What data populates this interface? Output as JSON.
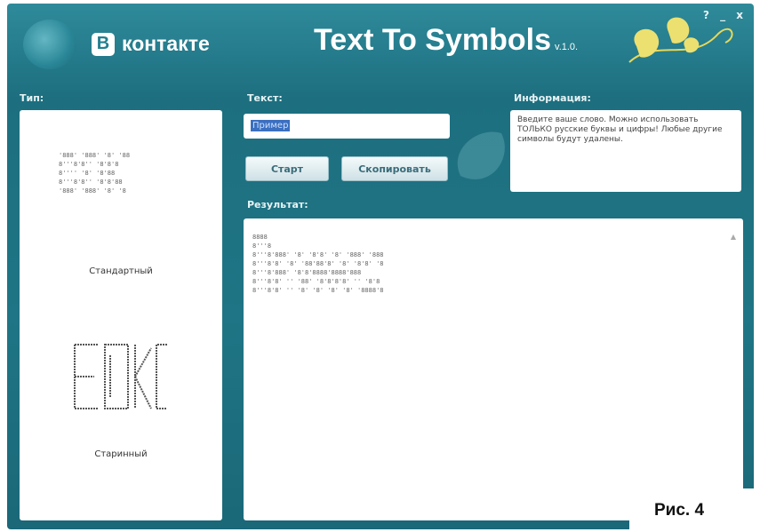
{
  "window": {
    "controls": "? _ x",
    "brand_icon": "B",
    "brand_text": "контакте",
    "app_title": "Text To Symbols",
    "app_version": "v.1.0."
  },
  "type_section": {
    "label": "Тип:",
    "standard_preview": "'888' '888' '8' '88\n8'''8'8'' '8'8'8\n8'''' '8' '8'88\n8'''8'8'' '8'8'88\n'888' '888' '8' '8",
    "standard_label": "Стандартный",
    "old_label": "Старинный"
  },
  "text_section": {
    "label": "Текст:",
    "input_value": "Пример"
  },
  "buttons": {
    "start": "Старт",
    "copy": "Скопировать"
  },
  "info_section": {
    "label": "Информация:",
    "text": "Введите ваше слово. Можно использовать ТОЛЬКО русские буквы и цифры! Любые другие символы будут удалены."
  },
  "result_section": {
    "label": "Результат:",
    "text": "8888\n8'''8\n8'''8'888' '8' '8'8' '8' '888' '888\n8'''8'8' '8' '88'88'8' '8' '8'8' '8\n8'''8'888' '8'8'8888'8888'888\n8'''8'8' '' '88' '8'8'8'8' '' '8'8\n8'''8'8' '' '8' '8' '8' '8' '8888'8"
  },
  "caption": "Рис. 4",
  "colors": {
    "window_bg": "#1f7585",
    "title_accent": "#ffffff",
    "leaf": "#e8d85a"
  }
}
